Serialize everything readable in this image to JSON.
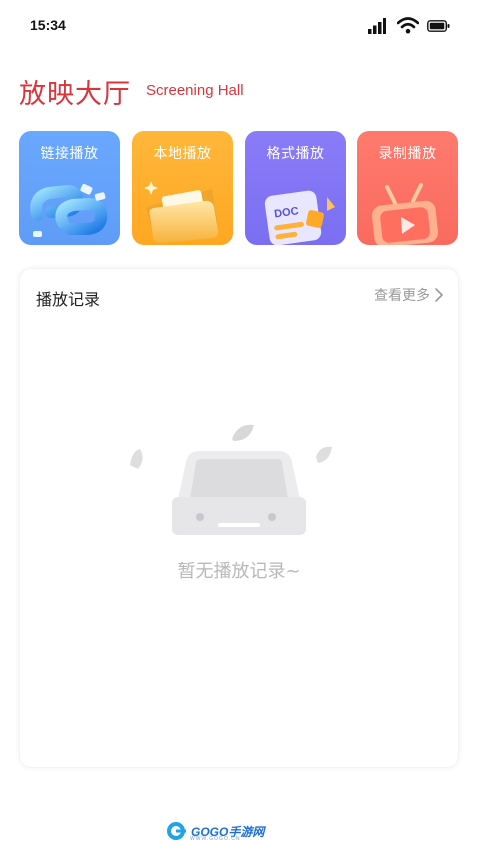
{
  "status_bar": {
    "time": "15:34"
  },
  "header": {
    "title": "放映大厅",
    "subtitle": "Screening Hall"
  },
  "cards": [
    {
      "label": "链接播放",
      "icon": "chain-link-icon",
      "color": "#6aa8ff"
    },
    {
      "label": "本地播放",
      "icon": "folder-icon",
      "color": "#ffb73a"
    },
    {
      "label": "格式播放",
      "icon": "doc-file-icon",
      "color": "#8a7cf8"
    },
    {
      "label": "录制播放",
      "icon": "tv-play-icon",
      "color": "#ff7a6d"
    }
  ],
  "history": {
    "title": "播放记录",
    "more_label": "查看更多",
    "empty_text": "暂无播放记录~"
  },
  "watermark": {
    "text": "GOGO手游网",
    "sub": "WWW.GOGO.CN"
  },
  "colors": {
    "accent": "#d9353d",
    "muted": "#9a9a9a",
    "empty": "#b8b8b8"
  }
}
